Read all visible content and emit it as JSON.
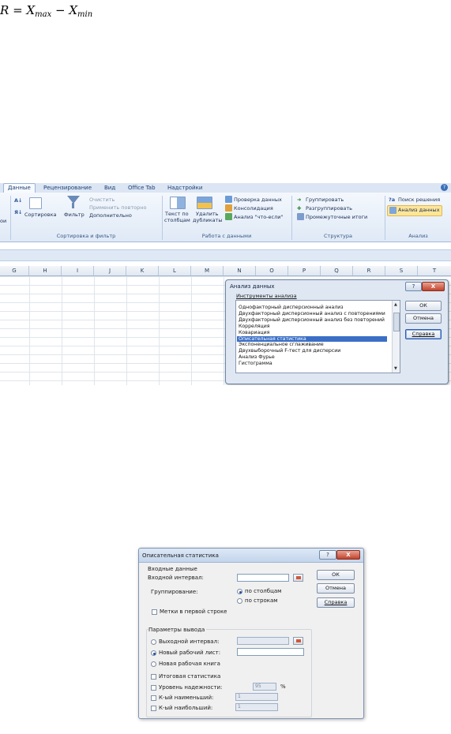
{
  "formula": {
    "lhs": "R",
    "eq": "=",
    "x": "X",
    "max": "max",
    "minus": "−",
    "min": "min"
  },
  "excel": {
    "tabs": [
      "Данные",
      "Рецензирование",
      "Вид",
      "Office Tab",
      "Надстройки"
    ],
    "ribbon": {
      "sort_az": "А↓",
      "sort_label": "Сортировка",
      "filter_label": "Фильтр",
      "clear": "Очистить",
      "reapply": "Применить повторно",
      "advanced": "Дополнительно",
      "sort_group": "Сортировка и фильтр",
      "text_to_columns_1": "Текст по",
      "text_to_columns_2": "столбцам",
      "remove_dup_1": "Удалить",
      "remove_dup_2": "дубликаты",
      "data_validation": "Проверка данных",
      "consolidate": "Консолидация",
      "what_if": "Анализ \"что-если\"",
      "data_tools_group": "Работа с данными",
      "group": "Группировать",
      "ungroup": "Разгруппировать",
      "subtotal": "Промежуточные итоги",
      "outline_group": "Структура",
      "solver": "Поиск решения",
      "data_analysis": "Анализ данных",
      "analysis_group": "Анализ",
      "cut_left": "ои"
    },
    "columns": [
      "G",
      "H",
      "I",
      "J",
      "K",
      "L",
      "M",
      "N",
      "O",
      "P",
      "Q",
      "R",
      "S",
      "T"
    ],
    "dialog": {
      "title": "Анализ данных",
      "tools_label": "Инструменты анализа",
      "help_glyph": "?",
      "close_glyph": "X",
      "items": [
        "Однофакторный дисперсионный анализ",
        "Двухфакторный дисперсионный анализ с повторениями",
        "Двухфакторный дисперсионный анализ без повторений",
        "Корреляция",
        "Ковариация",
        "Описательная статистика",
        "Экспоненциальное сглаживание",
        "Двухвыборочный F-тест для дисперсии",
        "Анализ Фурье",
        "Гистограмма"
      ],
      "selected_index": 5,
      "ok": "ОК",
      "cancel": "Отмена",
      "help": "Справка"
    }
  },
  "desc_dialog": {
    "title": "Описательная статистика",
    "help_glyph": "?",
    "close_glyph": "X",
    "input_section": "Входные данные",
    "input_range": "Входной интервал:",
    "grouping": "Группирование:",
    "by_columns": "по столбцам",
    "by_rows": "по строкам",
    "labels_first_row": "Метки в первой строке",
    "output_section": "Параметры вывода",
    "output_range": "Выходной интервал:",
    "new_sheet": "Новый рабочий лист:",
    "new_book": "Новая рабочая книга",
    "summary": "Итоговая статистика",
    "confidence": "Уровень надежности:",
    "confidence_value": "95",
    "percent": "%",
    "kth_smallest": "К-ый наименьший:",
    "kth_smallest_value": "1",
    "kth_largest": "К-ый наибольший:",
    "kth_largest_value": "1",
    "ok": "ОК",
    "cancel": "Отмена",
    "help": "Справка"
  }
}
